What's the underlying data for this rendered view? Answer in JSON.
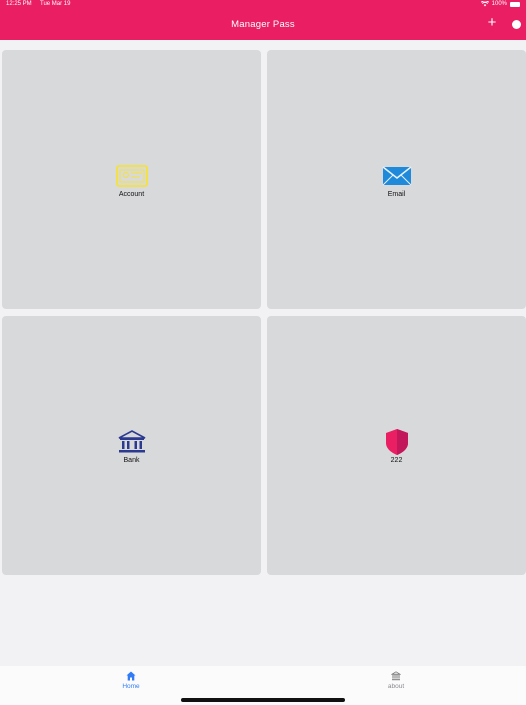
{
  "status_bar": {
    "time": "12:25 PM",
    "date": "Tue Mar 19",
    "battery": "100%"
  },
  "header": {
    "title": "Manager Pass",
    "add_label": "+",
    "color": "#e91e63"
  },
  "cards": [
    {
      "label": "Account",
      "icon": "id-card-icon",
      "color": "#f2e14c"
    },
    {
      "label": "Email",
      "icon": "envelope-icon",
      "color": "#1f8ad9"
    },
    {
      "label": "Bank",
      "icon": "bank-icon",
      "color": "#2b3a8f"
    },
    {
      "label": "222",
      "icon": "shield-icon",
      "color": "#e91e63"
    }
  ],
  "tabbar": {
    "tabs": [
      {
        "label": "Home",
        "icon": "home-icon",
        "active": true
      },
      {
        "label": "about",
        "icon": "bank-icon",
        "active": false
      }
    ],
    "active_color": "#2f7cf6"
  }
}
